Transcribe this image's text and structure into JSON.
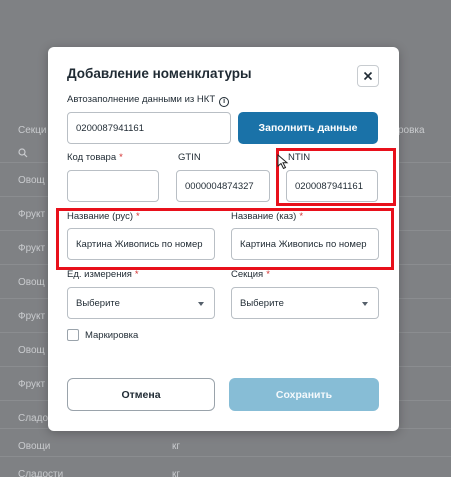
{
  "background": {
    "header_left": "Секци",
    "header_right": "ровка",
    "rows": [
      {
        "c1": "Овощ",
        "c2": ""
      },
      {
        "c1": "Фрукт",
        "c2": ""
      },
      {
        "c1": "Фрукт",
        "c2": ""
      },
      {
        "c1": "Овощ",
        "c2": ""
      },
      {
        "c1": "Фрукт",
        "c2": ""
      },
      {
        "c1": "Овощ",
        "c2": ""
      },
      {
        "c1": "Фрукт",
        "c2": ""
      },
      {
        "c1": "Сладо",
        "c2": ""
      },
      {
        "c1": "Овощи",
        "c2": "кг"
      },
      {
        "c1": "Сладости",
        "c2": "кг"
      }
    ]
  },
  "modal": {
    "title": "Добавление номенклатуры",
    "autofill_label": "Автозаполнение данными из НКТ",
    "autofill_value": "0200087941161",
    "fill_button": "Заполнить данные",
    "code_label": "Код товара",
    "code_value": "",
    "gtin_label": "GTIN",
    "gtin_value": "0000004874327",
    "ntin_label": "NTIN",
    "ntin_value": "0200087941161",
    "name_rus_label": "Название (рус)",
    "name_rus_value": "Картина Живопись по номер",
    "name_kaz_label": "Название (каз)",
    "name_kaz_value": "Картина Живопись по номер",
    "unit_label": "Ед. измерения",
    "unit_value": "Выберите",
    "section_label": "Секция",
    "section_value": "Выберите",
    "marking_label": "Маркировка",
    "required_mark": "*",
    "info_glyph": "i",
    "cancel_button": "Отмена",
    "save_button": "Сохранить"
  },
  "colors": {
    "primary": "#1a72a8",
    "save_disabled": "#87bdd6",
    "highlight": "#e8101b"
  }
}
